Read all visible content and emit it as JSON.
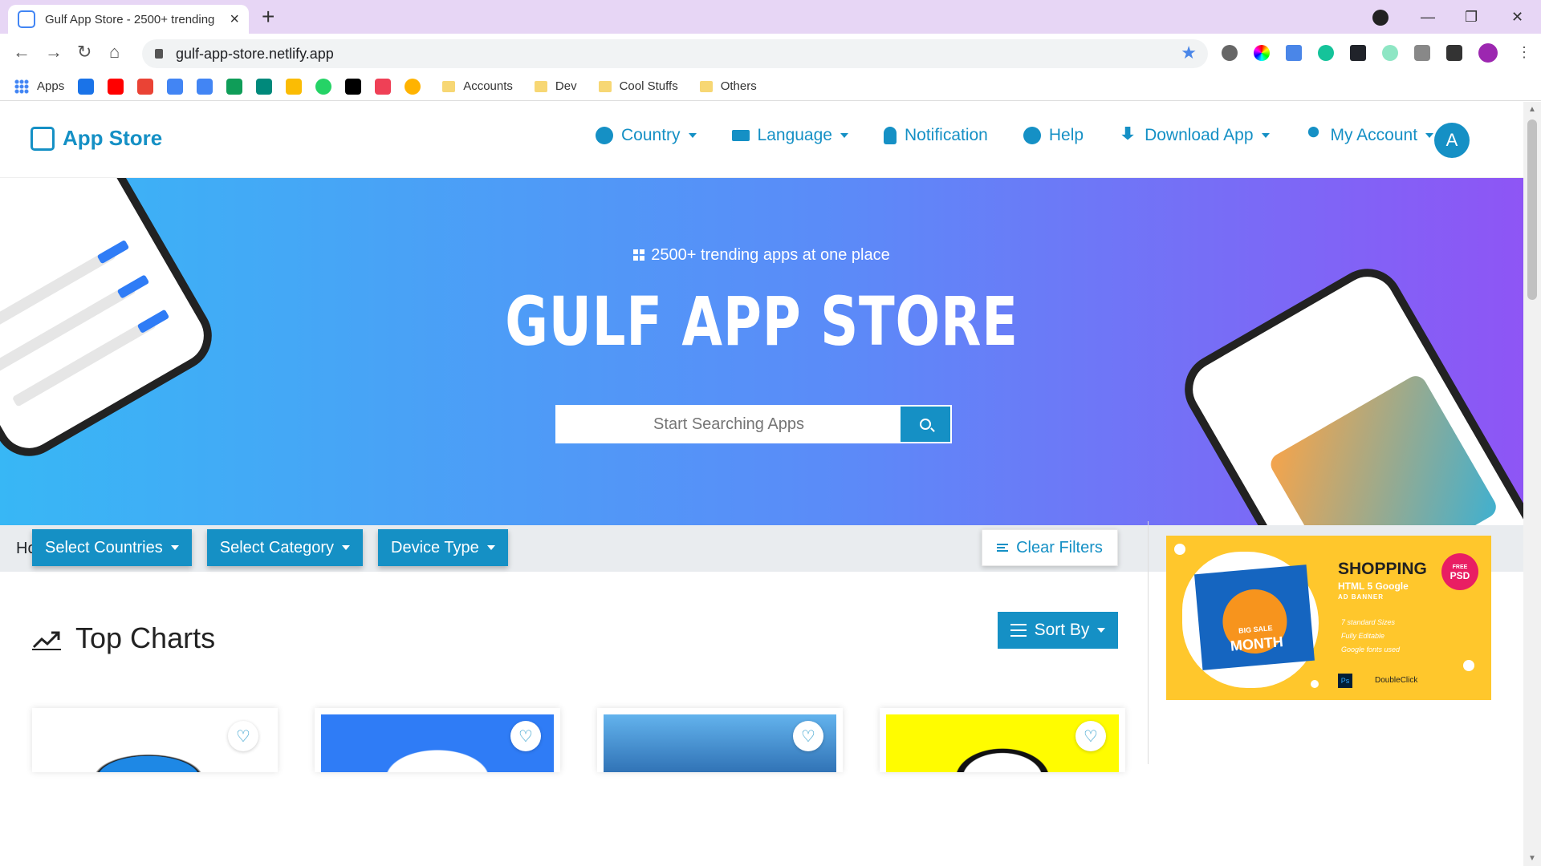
{
  "browser": {
    "tab_title": "Gulf App Store - 2500+ trending",
    "url": "gulf-app-store.netlify.app",
    "bookmarks": [
      "Apps",
      "Accounts",
      "Dev",
      "Cool Stuffs",
      "Others"
    ]
  },
  "navbar": {
    "brand": "App Store",
    "menu": [
      "Country",
      "Language",
      "Notification",
      "Help",
      "Download App",
      "My Account"
    ],
    "avatar_initial": "A"
  },
  "hero": {
    "tagline": "2500+ trending apps at one place",
    "title": "GULF APP STORE",
    "search_placeholder": "Start Searching Apps"
  },
  "breadcrumb": {
    "current": "Home"
  },
  "filters": {
    "countries": "Select Countries",
    "category": "Select Category",
    "device": "Device Type",
    "clear": "Clear Filters"
  },
  "charts": {
    "heading": "Top Charts",
    "sort": "Sort By"
  },
  "ad": {
    "headline": "SHOPPING",
    "sub": "HTML 5 Google",
    "sub2": "AD BANNER",
    "items": [
      "7 standard Sizes",
      "Fully Editable",
      "Google fonts used"
    ],
    "badge_top": "FREE",
    "badge_main": "PSD",
    "box_small": "BIG SALE",
    "box_main": "MONTH",
    "ps": "Ps",
    "dc": "DoubleClick"
  },
  "colors": {
    "primary": "#1590c5",
    "hero_start": "#38b7f5",
    "hero_end": "#8e55f5"
  }
}
